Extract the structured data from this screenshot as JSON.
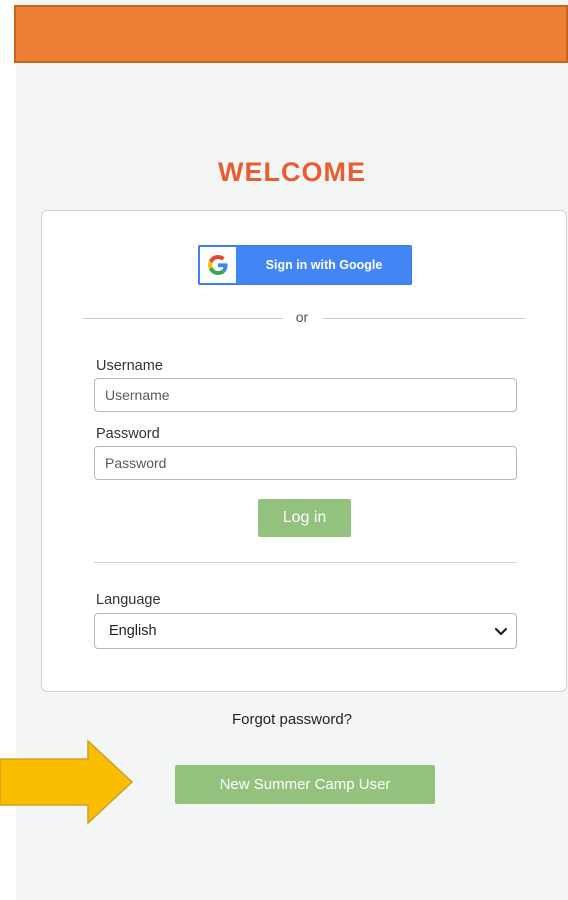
{
  "header": {
    "color": "#ee8033"
  },
  "welcome": {
    "title": "WELCOME",
    "color": "#ea5d31"
  },
  "google": {
    "label": "Sign in with Google",
    "icon": "google-g-icon"
  },
  "divider": {
    "text": "or"
  },
  "username": {
    "label": "Username",
    "placeholder": "Username",
    "value": ""
  },
  "password": {
    "label": "Password",
    "placeholder": "Password",
    "value": ""
  },
  "login": {
    "label": "Log in",
    "color": "#93c27e"
  },
  "language": {
    "label": "Language",
    "selected": "English",
    "icon": "chevron-down-icon"
  },
  "forgot": {
    "label": "Forgot password?"
  },
  "new_user": {
    "label": "New Summer Camp User",
    "color": "#93c27e"
  },
  "annotation": {
    "icon": "arrow-right-icon",
    "color": "#fbbd00"
  }
}
